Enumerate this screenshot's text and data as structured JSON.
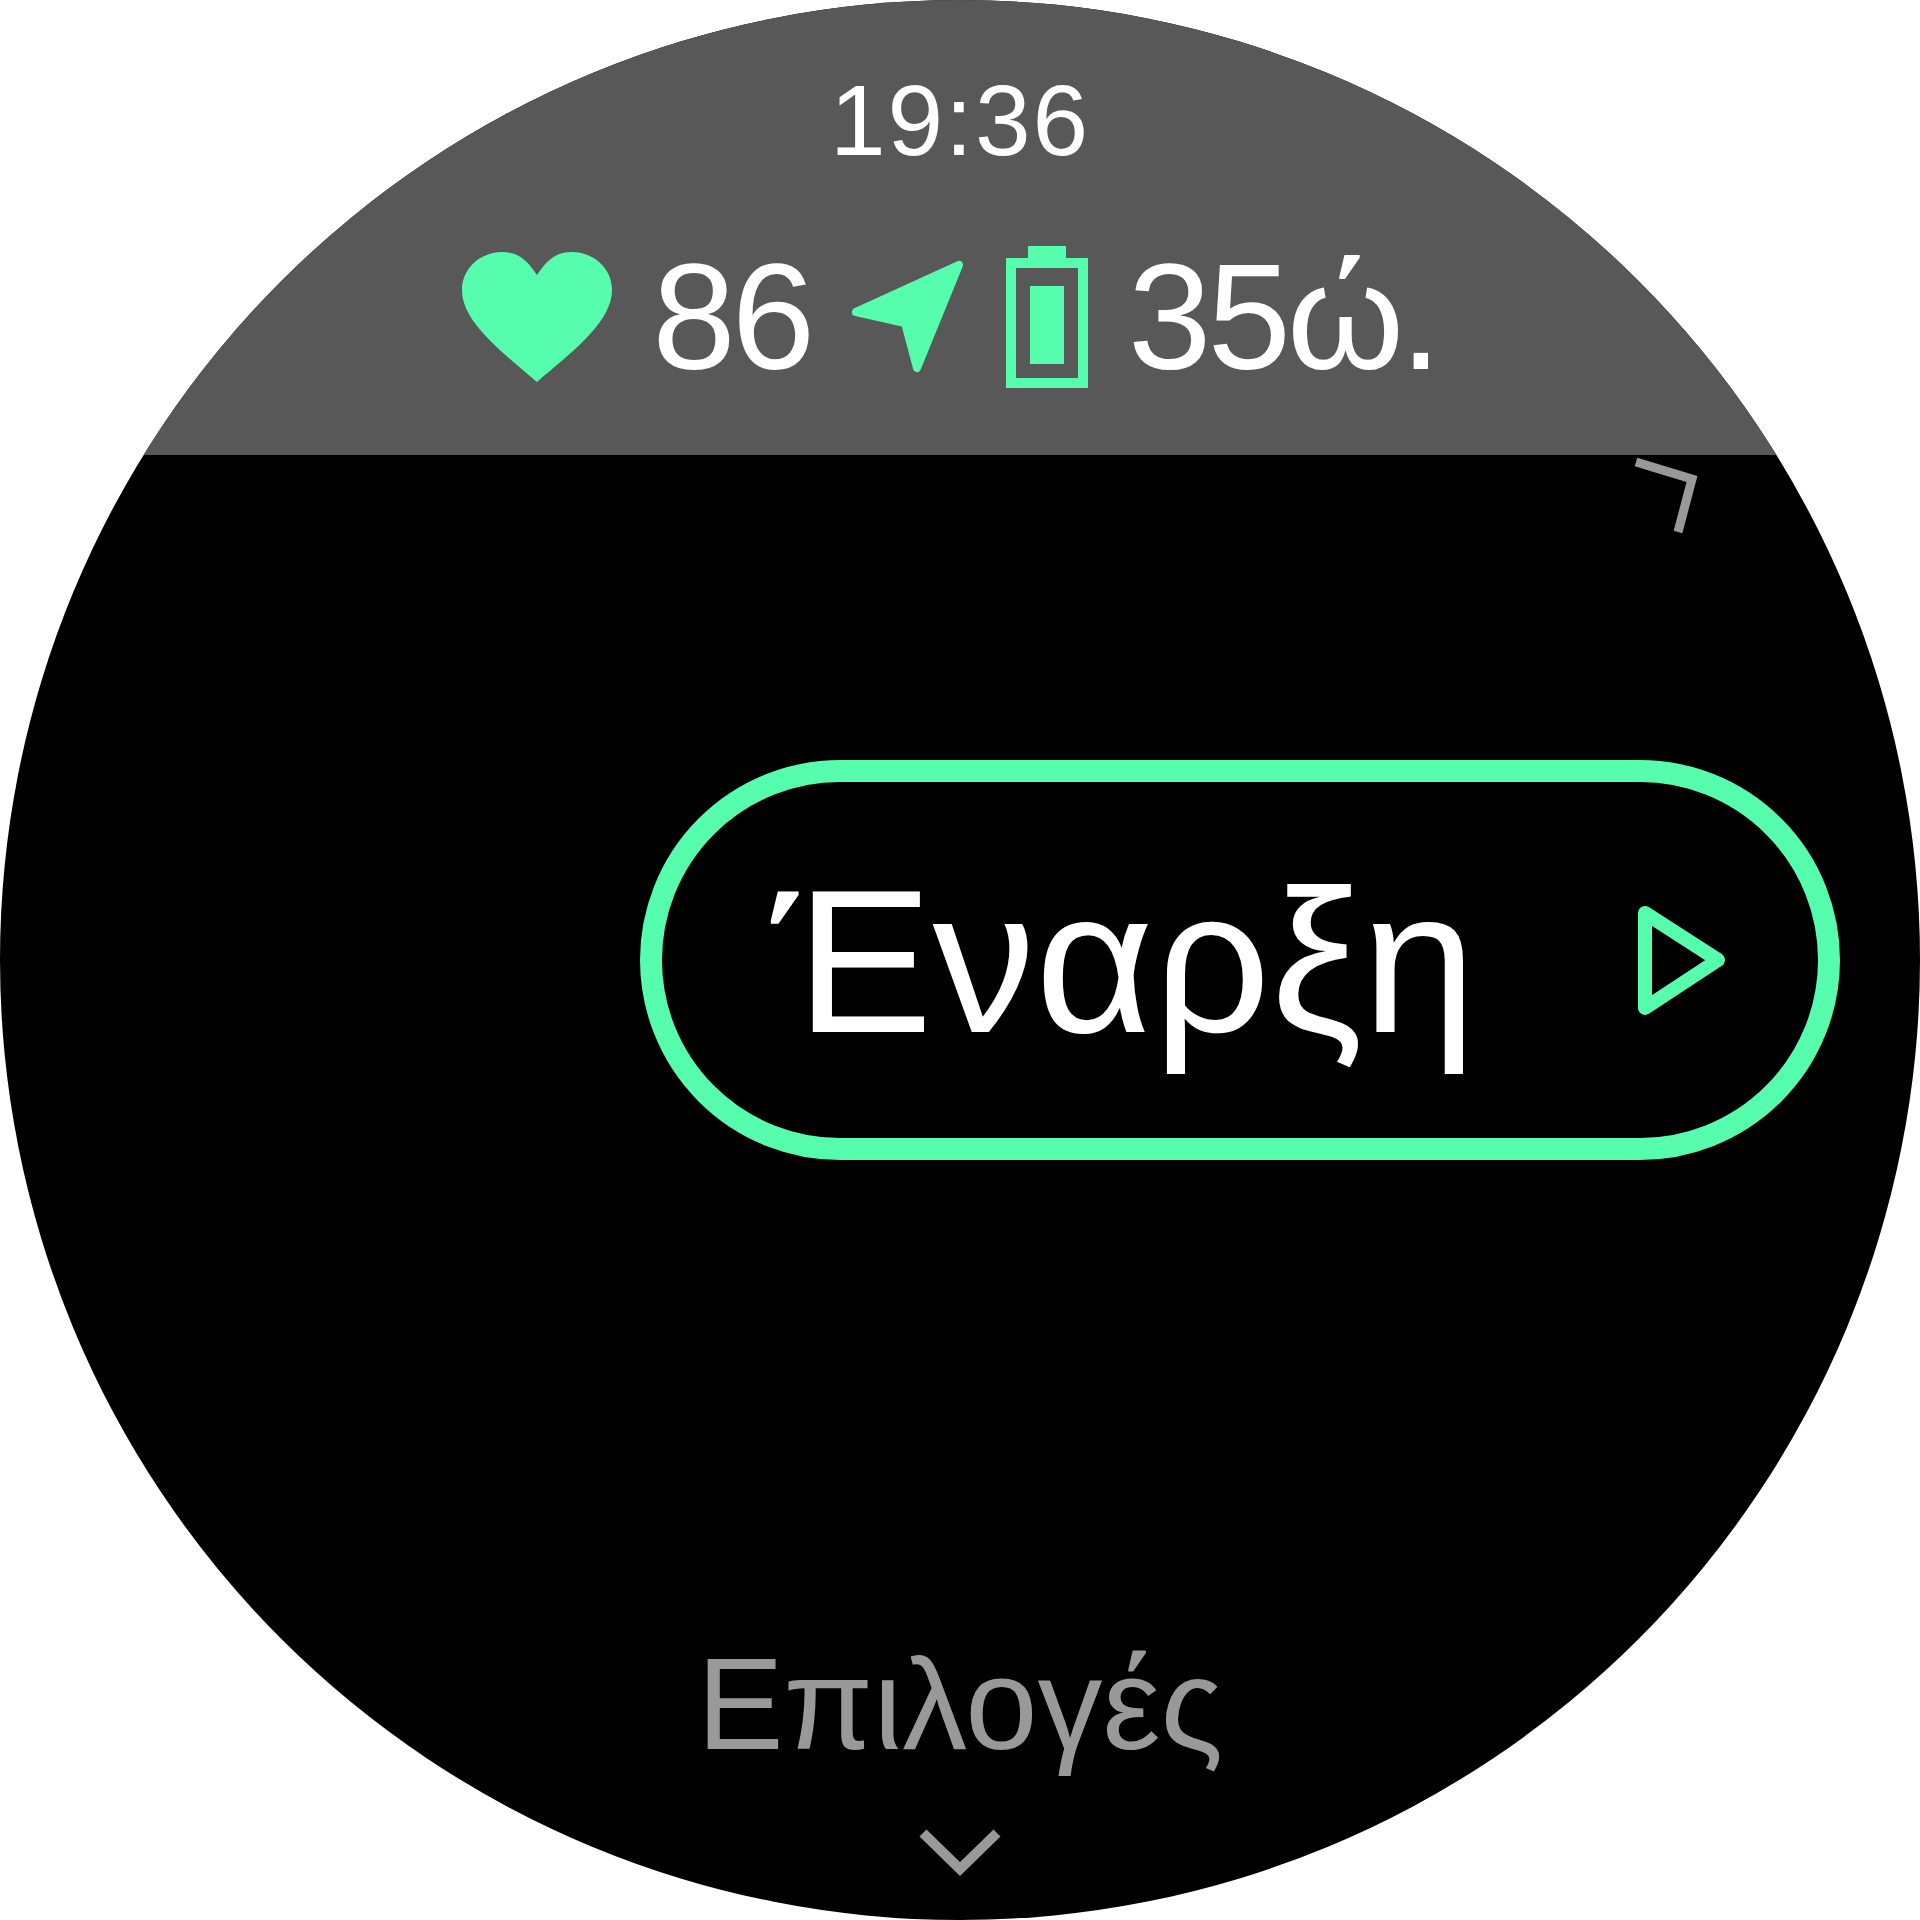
{
  "status_bar": {
    "time": "19:36",
    "heart_rate": "86",
    "battery_time": "35ώ."
  },
  "start_button": {
    "label": "Έναρξη"
  },
  "options": {
    "label": "Επιλογές"
  }
}
